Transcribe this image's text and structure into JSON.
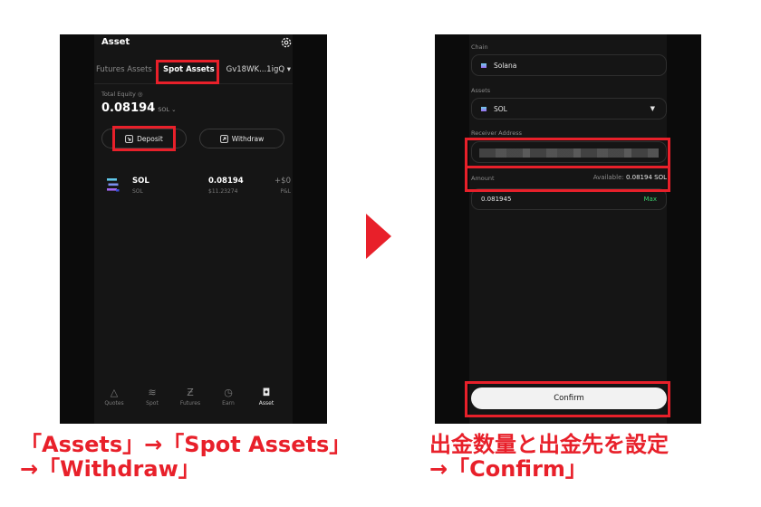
{
  "left_screen": {
    "header_title": "Asset",
    "tabs": {
      "futures": "Futures Assets",
      "spot": "Spot Assets",
      "account": "Gv18WK...1igQ ▾"
    },
    "total_equity_label": "Total Equity ◎",
    "total_equity_value": "0.08194",
    "total_equity_unit": "SOL ⌄",
    "deposit_label": "Deposit",
    "withdraw_label": "Withdraw",
    "asset_row": {
      "name": "SOL",
      "sub": "SOL",
      "amount": "0.08194",
      "usd": "$11.23274",
      "pnl": "+$0",
      "pnl_label": "P&L"
    },
    "nav": [
      {
        "label": "Quotes",
        "icon": "△"
      },
      {
        "label": "Spot",
        "icon": "≋"
      },
      {
        "label": "Futures",
        "icon": "Ƶ"
      },
      {
        "label": "Earn",
        "icon": "◷"
      },
      {
        "label": "Asset",
        "icon": "◘"
      }
    ]
  },
  "right_screen": {
    "chain_label": "Chain",
    "chain_value": "Solana",
    "assets_label": "Assets",
    "assets_value": "SOL",
    "assets_caret": "▼",
    "receiver_label": "Receiver Address",
    "amount_label": "Amount",
    "available_prefix": "Available:",
    "available_value": "0.08194 SOL",
    "amount_value": "0.081945",
    "max_label": "Max",
    "confirm_label": "Confirm"
  },
  "captions": {
    "left_line1": "「Assets」→「Spot Assets」",
    "left_line2": "→「Withdraw」",
    "right_line1": "出金数量と出金先を設定",
    "right_line2": "→「Confirm」"
  },
  "colors": {
    "annotation_red": "#e8202a",
    "screen_bg": "#0b0b0b",
    "max_green": "#3ccf6e"
  }
}
